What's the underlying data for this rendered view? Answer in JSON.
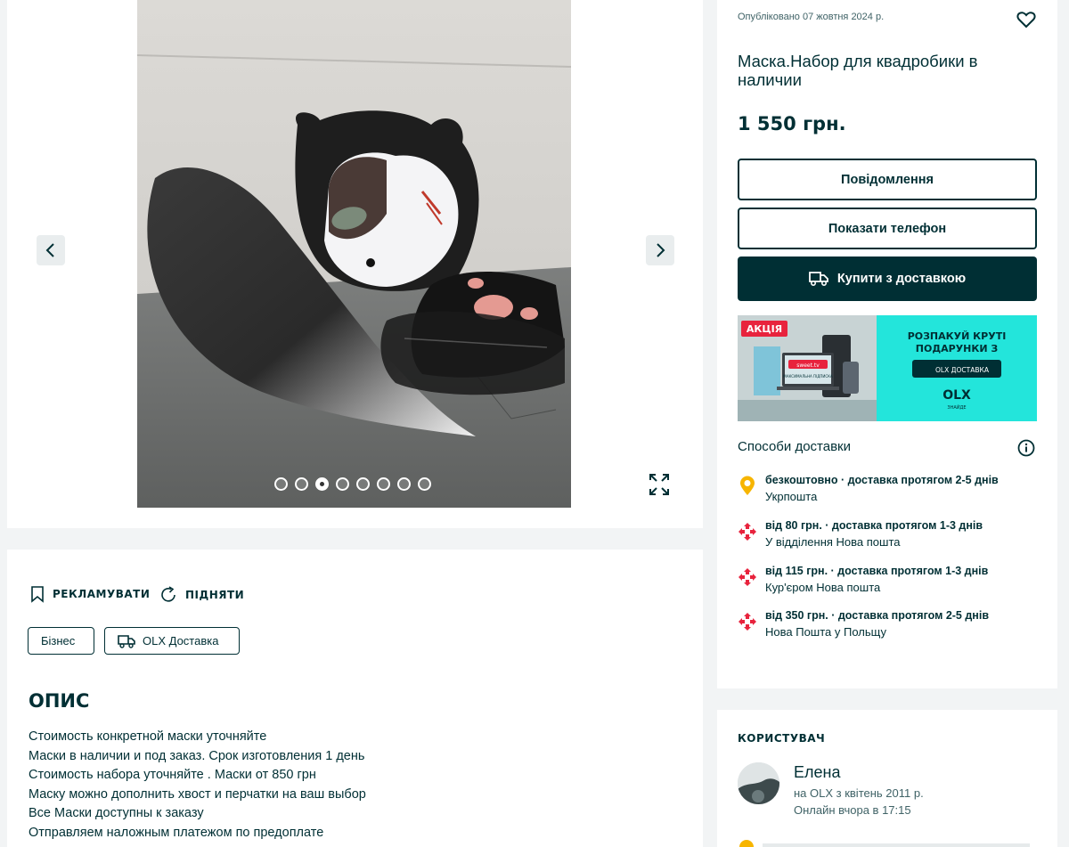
{
  "gallery": {
    "total_images": 8,
    "active_index": 2,
    "prev_icon": "chevron-left-icon",
    "next_icon": "chevron-right-icon",
    "expand_icon": "expand-icon"
  },
  "actions": {
    "promote_label": "РЕКЛАМУВАТИ",
    "refresh_label": "ПІДНЯТИ"
  },
  "tags": {
    "business": "Бізнес",
    "olx_delivery": "OLX Доставка"
  },
  "description": {
    "title": "ОПИС",
    "lines": [
      "Стоимость конкретной маски уточняйте",
      "Маски в наличии и под заказ. Срок изготовления 1 день",
      "Стоимость набора уточняйте . Маски от 850 грн",
      "Маску можно дополнить хвост и перчатки на ваш выбор",
      "Все Маски доступны к заказу",
      "Отправляем наложным платежом по предоплате"
    ]
  },
  "listing": {
    "published": "Опубліковано 07 жовтня 2024 р.",
    "title": "Маска.Набор для квадробики в наличии",
    "price": "1 550 грн.",
    "message_button": "Повідомлення",
    "phone_button": "Показати телефон",
    "buy_button": "Купити з доставкою"
  },
  "banner": {
    "badge": "АКЦІЯ",
    "headline_1": "РОЗПАКУЙ КРУТІ",
    "headline_2": "ПОДАРУНКИ З",
    "pill": "OLX ДОСТАВКА",
    "logo": "OLX",
    "logo_sub": "ЗНАЙДЕ",
    "screen_brand": "sweet.tv",
    "screen_text": "МАКСИМАЛЬНА ПІДПИСКА",
    "accent": "#23e5db"
  },
  "delivery": {
    "title": "Способи доставки",
    "options": [
      {
        "main": "безкоштовно · доставка протягом 2-5 днів",
        "sub": "Укрпошта",
        "icon": "ukrposhta-icon"
      },
      {
        "main": "від 80 грн. · доставка протягом 1-3 днів",
        "sub": "У відділення Нова пошта",
        "icon": "nova-poshta-icon"
      },
      {
        "main": "від 115 грн. · доставка протягом 1-3 днів",
        "sub": "Кур'єром Нова пошта",
        "icon": "nova-poshta-icon"
      },
      {
        "main": "від 350 грн. · доставка протягом 2-5 днів",
        "sub": "Нова Пошта у Польщу",
        "icon": "nova-poshta-icon"
      }
    ]
  },
  "user": {
    "heading": "КОРИСТУВАЧ",
    "name": "Елена",
    "since": "на OLX з квітень 2011 р.",
    "online": "Онлайн вчора в 17:15"
  },
  "colors": {
    "primary": "#002f34",
    "background": "#f2f4f5",
    "banner_teal": "#23e5db",
    "nova_poshta_red": "#e8233d",
    "ukrposhta_yellow": "#f7b500"
  }
}
